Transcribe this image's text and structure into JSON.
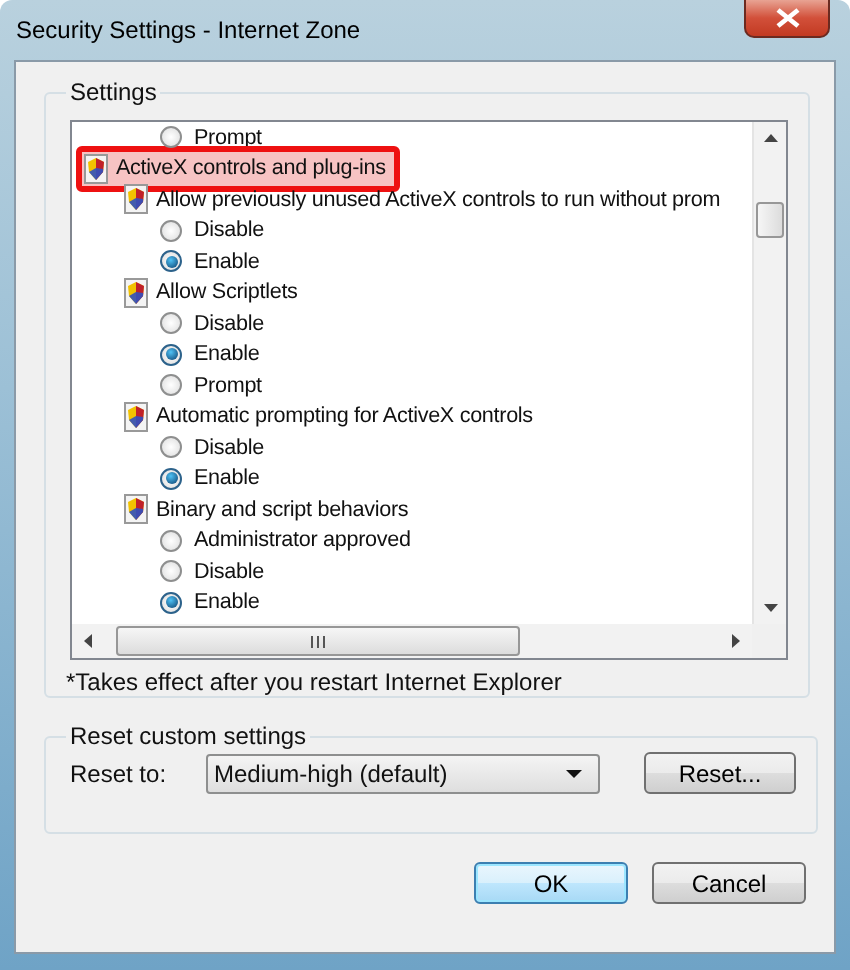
{
  "window": {
    "title": "Security Settings - Internet Zone"
  },
  "settings": {
    "label": "Settings",
    "items": [
      {
        "kind": "option",
        "label": "Prompt",
        "selected": false
      },
      {
        "kind": "group",
        "label": "ActiveX controls and plug-ins",
        "highlighted": true,
        "children": [
          {
            "kind": "group",
            "label": "Allow previously unused ActiveX controls to run without prom",
            "highlighted": false,
            "children": [
              {
                "kind": "option",
                "label": "Disable",
                "selected": false
              },
              {
                "kind": "option",
                "label": "Enable",
                "selected": true
              }
            ]
          },
          {
            "kind": "group",
            "label": "Allow Scriptlets",
            "highlighted": false,
            "children": [
              {
                "kind": "option",
                "label": "Disable",
                "selected": false
              },
              {
                "kind": "option",
                "label": "Enable",
                "selected": true
              },
              {
                "kind": "option",
                "label": "Prompt",
                "selected": false
              }
            ]
          },
          {
            "kind": "group",
            "label": "Automatic prompting for ActiveX controls",
            "highlighted": false,
            "children": [
              {
                "kind": "option",
                "label": "Disable",
                "selected": false
              },
              {
                "kind": "option",
                "label": "Enable",
                "selected": true
              }
            ]
          },
          {
            "kind": "group",
            "label": "Binary and script behaviors",
            "highlighted": false,
            "children": [
              {
                "kind": "option",
                "label": "Administrator approved",
                "selected": false
              },
              {
                "kind": "option",
                "label": "Disable",
                "selected": false
              },
              {
                "kind": "option",
                "label": "Enable",
                "selected": true
              }
            ]
          }
        ]
      }
    ],
    "note": "*Takes effect after you restart Internet Explorer"
  },
  "reset": {
    "label": "Reset custom settings",
    "reset_to_label": "Reset to:",
    "dropdown": {
      "value": "Medium-high (default)"
    },
    "reset_button": "Reset..."
  },
  "buttons": [
    {
      "label": "OK",
      "default": true
    },
    {
      "label": "Cancel",
      "default": false
    }
  ]
}
